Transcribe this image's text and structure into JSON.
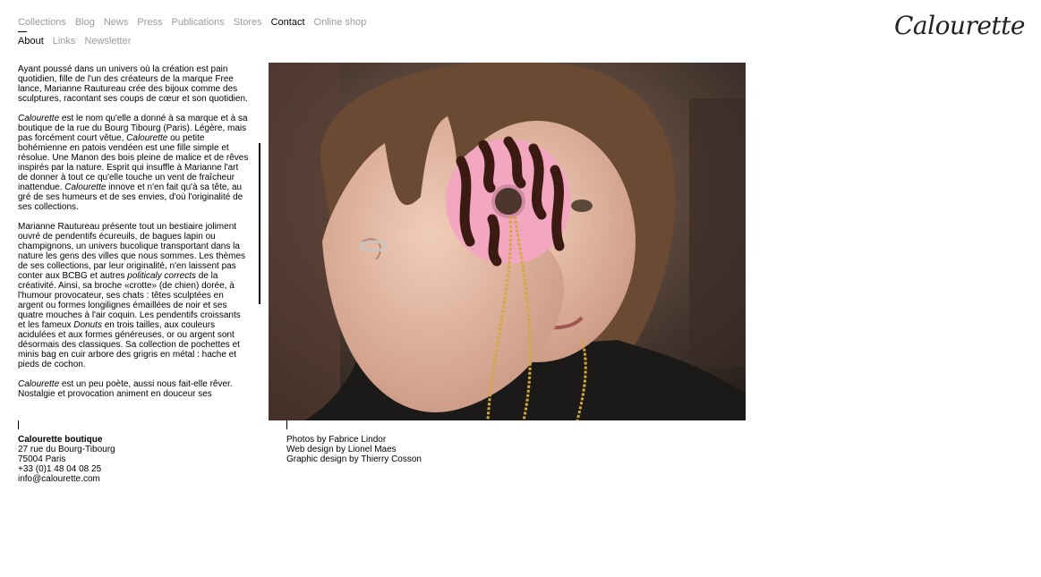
{
  "nav": {
    "primary": [
      "Collections",
      "Blog",
      "News",
      "Press",
      "Publications",
      "Stores",
      "Contact",
      "Online shop"
    ],
    "secondary": [
      "About",
      "Links",
      "Newsletter"
    ]
  },
  "logo": "Calourette",
  "about": {
    "p1": "Ayant poussé dans un univers où la création est pain quotidien, fille de l'un des créateurs de la marque Free lance, Marianne Rautureau crée des bijoux comme des sculptures, racontant ses coups de cœur et son quotidien.",
    "p2_em1": "Calourette",
    "p2_t1": " est le nom qu'elle a donné à sa marque et à sa boutique de la rue du Bourg Tibourg (Paris). Légère, mais pas forcément court vêtue, ",
    "p2_em2": "Calourette",
    "p2_t2": " ou petite bohémienne en patois vendéen est une fille simple et résolue. Une Manon des bois pleine de malice et de rêves inspirés par la nature. Esprit qui insuffle à Marianne l'art de donner à tout ce qu'elle touche un vent de fraîcheur inattendue. ",
    "p2_em3": "Calourette",
    "p2_t3": " innove et n'en fait qu'à sa tête, au gré de ses humeurs et de ses envies, d'où l'originalité de ses collections.",
    "p3_t1": "Marianne Rautureau présente tout un bestiaire joliment ouvré de pendentifs écureuils, de bagues lapin ou champignons, un univers bucolique transportant dans la nature les gens des villes que nous sommes. Les thèmes de ses collections, par leur originalité, n'en laissent pas conter aux BCBG et autres ",
    "p3_em1": "politicaly corrects",
    "p3_t2": " de la créativité. Ainsi, sa broche «crotte» (de chien) dorée, à l'humour provocateur, ses chats : têtes sculptées en argent ou formes longilignes émaillées de noir et ses quatre mouches à l'air coquin. Les pendentifs croissants et les fameux ",
    "p3_em2": "Donuts",
    "p3_t3": " en trois tailles, aux couleurs acidulées et aux formes généreuses, or ou argent sont désormais des classiques. Sa collection de pochettes et minis bag en cuir arbore des grigris en métal : hache et pieds de cochon.",
    "p4_em1": "Calourette",
    "p4_t1": " est un peu poète, aussi nous fait-elle rêver. Nostalgie et provocation animent en douceur ses"
  },
  "boutique": {
    "name": "Calourette boutique",
    "street": "27 rue du Bourg-Tibourg",
    "city": "75004 Paris",
    "phone": "+33 (0)1 48 04 08 25",
    "email": "info@calourette.com"
  },
  "credits": {
    "photos": "Photos by Fabrice Lindor",
    "web": "Web design by Lionel Maes",
    "graphic": "Graphic design by Thierry Cosson"
  },
  "colors": {
    "nav_inactive": "#9a9a9a",
    "active": "#000000",
    "donut_glaze": "#f2a6c0",
    "donut_stripe": "#3b1a12",
    "chain_gold": "#d6a83a"
  }
}
